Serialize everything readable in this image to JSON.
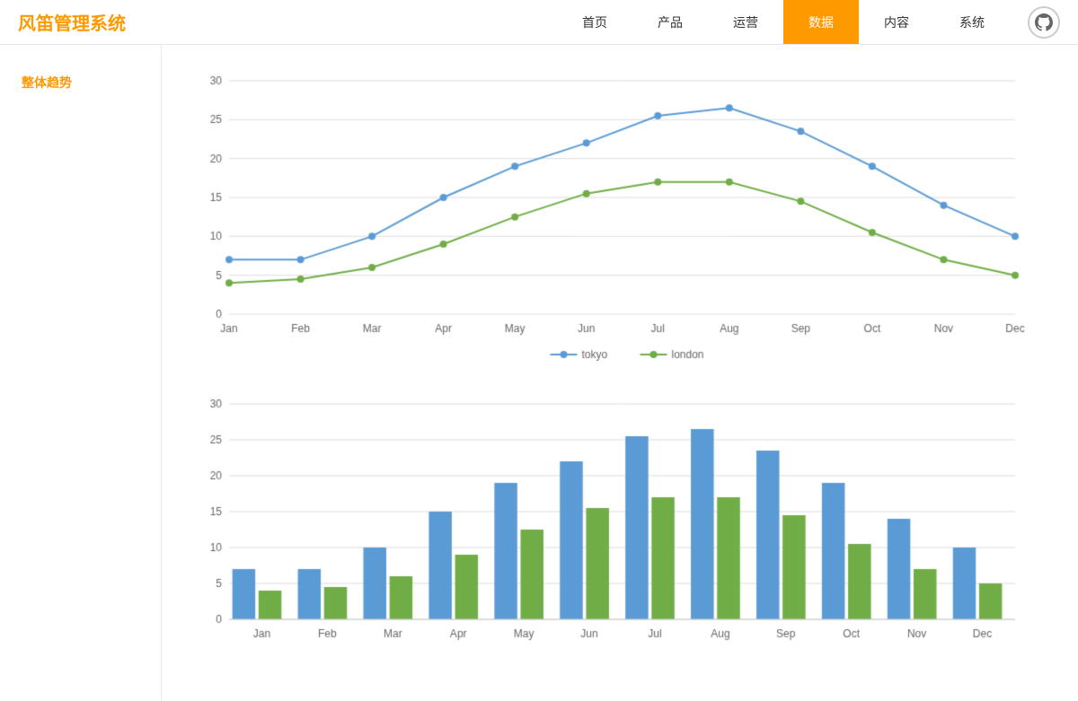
{
  "app": {
    "title": "风笛管理系统"
  },
  "nav": {
    "items": [
      {
        "label": "首页",
        "active": false
      },
      {
        "label": "产品",
        "active": false
      },
      {
        "label": "运营",
        "active": false
      },
      {
        "label": "数据",
        "active": true
      },
      {
        "label": "内容",
        "active": false
      },
      {
        "label": "系统",
        "active": false
      }
    ]
  },
  "sidebar": {
    "items": [
      {
        "label": "整体趋势"
      }
    ]
  },
  "chart": {
    "months": [
      "Jan",
      "Feb",
      "Mar",
      "Apr",
      "May",
      "Jun",
      "Jul",
      "Aug",
      "Sep",
      "Oct",
      "Nov",
      "Dec"
    ],
    "tokyo": [
      7,
      7,
      10,
      15,
      19,
      22,
      25.5,
      26.5,
      23.5,
      19,
      14,
      10
    ],
    "london": [
      4,
      4.5,
      6,
      9,
      12.5,
      15.5,
      17,
      17,
      14.5,
      10.5,
      7,
      5
    ],
    "yMax": 30,
    "yTicks": [
      0,
      5,
      10,
      15,
      20,
      25,
      30
    ],
    "legend": {
      "tokyo": "tokyo",
      "london": "london"
    },
    "colors": {
      "tokyo": "#5b9bd5",
      "london": "#70ad47"
    }
  }
}
